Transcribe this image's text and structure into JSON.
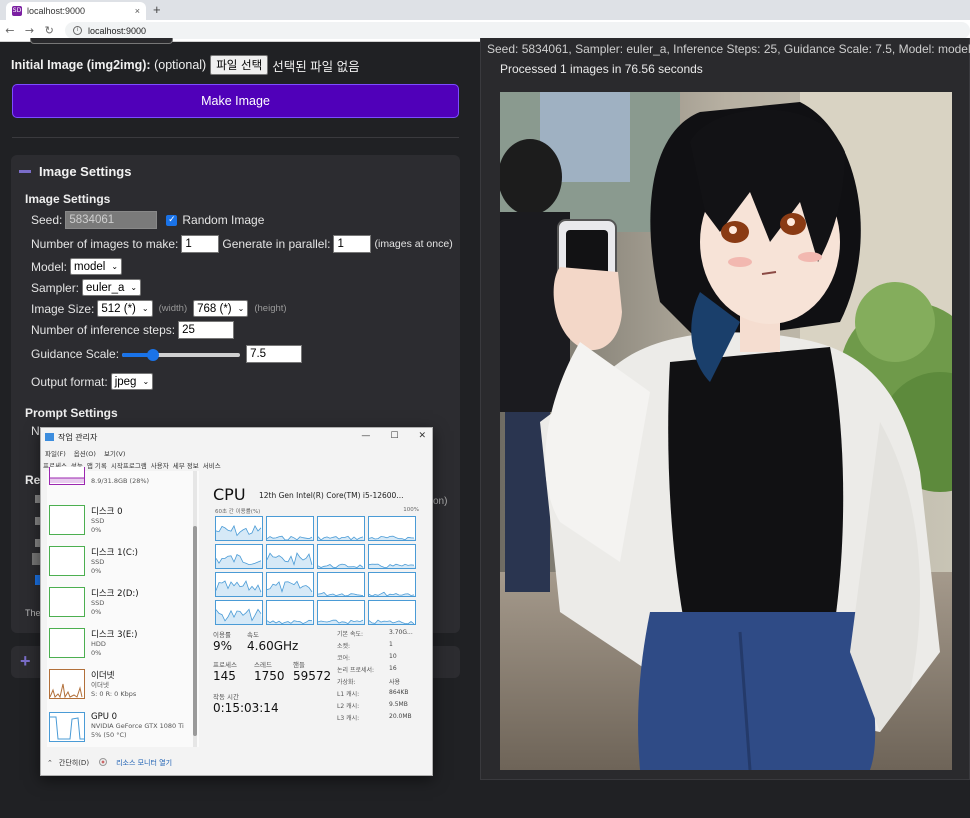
{
  "browser": {
    "tab_title": "localhost:9000",
    "favicon": "SD",
    "url": "localhost:9000",
    "new_tab": "+",
    "close": "×"
  },
  "left": {
    "init_label": "Initial Image (img2img):",
    "optional": "(optional)",
    "file_button": "파일 선택",
    "no_file": "선택된 파일 없음",
    "make_button": "Make Image",
    "panel_title": "Image Settings",
    "image_settings_head": "Image Settings",
    "seed_label": "Seed:",
    "seed_value": "5834061",
    "random_label": "Random Image",
    "num_images_label": "Number of images to make:",
    "num_images_value": "1",
    "parallel_label": "Generate in parallel:",
    "parallel_value": "1",
    "parallel_hint": "(images at once)",
    "model_label": "Model:",
    "model_value": "model",
    "sampler_label": "Sampler:",
    "sampler_value": "euler_a",
    "size_label": "Image Size:",
    "width_value": "512 (*)",
    "width_hint": "(width)",
    "height_value": "768 (*)",
    "height_hint": "(height)",
    "steps_label": "Number of inference steps:",
    "steps_value": "25",
    "guidance_label": "Guidance Scale:",
    "guidance_value": "7.5",
    "guidance_fraction": 0.26,
    "format_label": "Output format:",
    "format_value": "jpeg",
    "prompt_head": "Prompt Settings",
    "partial_n": "N",
    "partial_re": "Re",
    "partial_on": "on)",
    "partial_the": "The"
  },
  "right": {
    "seed_line": "Seed: 5834061, Sampler: euler_a, Inference Steps: 25, Guidance Scale: 7.5, Model: model",
    "processed": "Processed 1 images in 76.56 seconds"
  },
  "taskmgr": {
    "title": "작업 관리자",
    "menu": [
      "파일(F)",
      "옵션(O)",
      "보기(V)"
    ],
    "tabs": [
      "프로세스",
      "성능",
      "앱 기록",
      "시작프로그램",
      "사용자",
      "세부 정보",
      "서비스"
    ],
    "memory_sub": "8.9/31.8GB (28%)",
    "items": [
      {
        "name": "디스크 0",
        "sub1": "SSD",
        "sub2": "0%"
      },
      {
        "name": "디스크 1(C:)",
        "sub1": "SSD",
        "sub2": "0%"
      },
      {
        "name": "디스크 2(D:)",
        "sub1": "SSD",
        "sub2": "0%"
      },
      {
        "name": "디스크 3(E:)",
        "sub1": "HDD",
        "sub2": "0%"
      },
      {
        "name": "이더넷",
        "sub1": "이더넷",
        "sub2": "S: 0 R: 0 Kbps"
      },
      {
        "name": "GPU 0",
        "sub1": "NVIDIA GeForce GTX 1080 Ti",
        "sub2": "5% (50 °C)"
      }
    ],
    "cpu_title": "CPU",
    "cpu_model": "12th Gen Intel(R) Core(TM) i5-12600...",
    "util_caption": "60초 간 이용률(%)",
    "util_max": "100%",
    "stats": {
      "usage_label": "이용률",
      "usage_value": "9%",
      "speed_label": "속도",
      "speed_value": "4.60GHz",
      "proc_label": "프로세스",
      "proc_value": "145",
      "thread_label": "스레드",
      "thread_value": "1750",
      "handle_label": "핸들",
      "handle_value": "59572",
      "uptime_label": "작동 시간",
      "uptime_value": "0:15:03:14"
    },
    "kv": [
      {
        "k": "기본 속도:",
        "v": "3.70G..."
      },
      {
        "k": "소켓:",
        "v": "1"
      },
      {
        "k": "코어:",
        "v": "10"
      },
      {
        "k": "논리 프로세서:",
        "v": "16"
      },
      {
        "k": "가상화:",
        "v": "사용"
      },
      {
        "k": "L1 캐시:",
        "v": "864KB"
      },
      {
        "k": "L2 캐시:",
        "v": "9.5MB"
      },
      {
        "k": "L3 캐시:",
        "v": "20.0MB"
      }
    ],
    "fewer": "간단히(D)",
    "monitor": "리소스 모니터 열기"
  },
  "colors": {
    "accent": "#5000b9",
    "graph": "#4a9bd6",
    "memory": "#9c27b0",
    "disk": "#4caf50",
    "ethernet": "#b2703a"
  }
}
